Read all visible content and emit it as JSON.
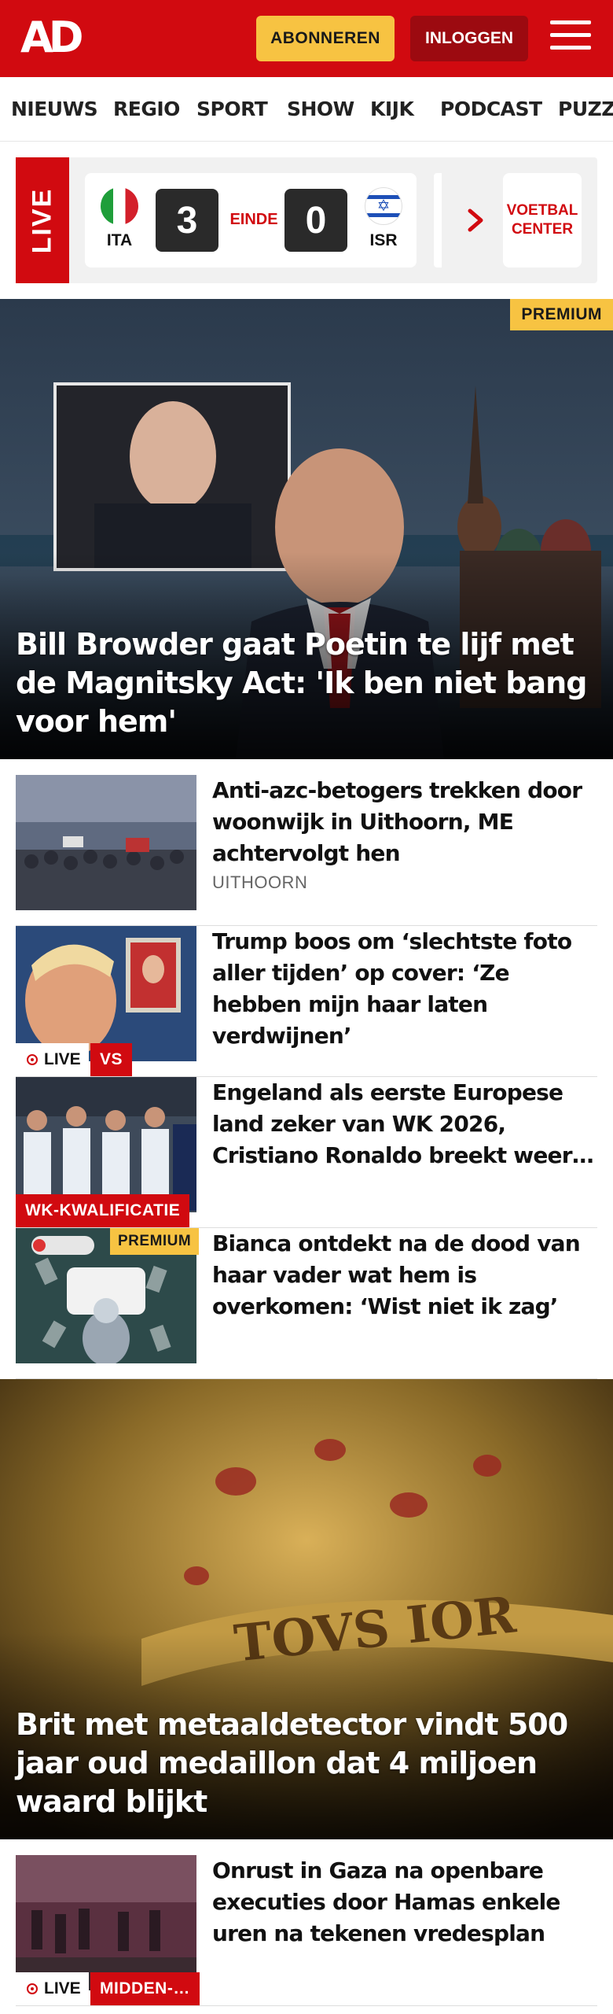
{
  "header": {
    "logo": "AD",
    "subscribe_label": "ABONNEREN",
    "login_label": "INLOGGEN",
    "brand_color": "#d10a10",
    "accent_color": "#f7c342"
  },
  "nav": {
    "items": [
      "NIEUWS",
      "REGIO",
      "SPORT",
      "SHOW",
      "KIJK",
      "PODCAST",
      "PUZZ"
    ]
  },
  "live": {
    "label": "LIVE",
    "home_team": "ITA",
    "away_team": "ISR",
    "home_score": "3",
    "away_score": "0",
    "status": "EINDE",
    "voetbal_center_label": "VOETBAL CENTER"
  },
  "hero": {
    "premium_label": "PREMIUM",
    "title": "Bill Browder gaat Poetin te lijf met de Magnitsky Act: 'Ik ben niet bang voor hem'"
  },
  "articles": [
    {
      "title": "Anti-azc-betogers trekken door woonwijk in Uithoorn, ME achter­volgt hen",
      "subtitle": "UITHOORN"
    },
    {
      "title": "Trump boos om ‘slechtste foto aller tijden’ op cover: ‘Ze hebben mijn haar laten verdwijnen’",
      "live_label": "LIVE",
      "tag": "VS"
    },
    {
      "title": "Engeland als eerste Europese land zeker van WK 2026, Cristiano Ronaldo breekt weer…",
      "tag": "WK-KWALIFICATIE"
    },
    {
      "title": "Bianca ontdekt na de dood van haar vader wat hem is overkomen: ‘Wist niet ik zag’",
      "premium_label": "PREMIUM"
    }
  ],
  "hero2": {
    "title": "Brit met metaaldetector vindt 500 jaar oud medaillon dat 4 miljoen waard blijkt"
  },
  "articles2": [
    {
      "title": "Onrust in Gaza na openbare executies door Hamas enkele uren na tekenen vredesplan",
      "live_label": "LIVE",
      "tag": "MIDDEN-…"
    }
  ]
}
